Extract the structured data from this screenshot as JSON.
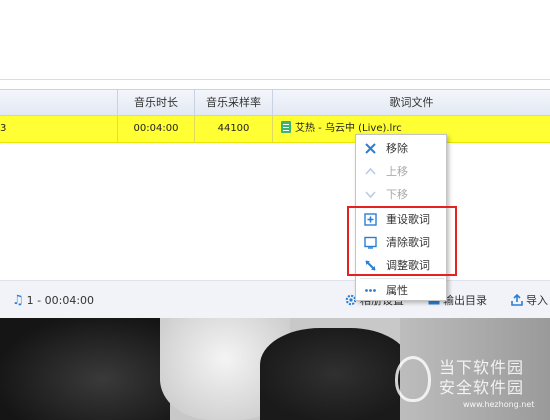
{
  "table": {
    "columns": [
      "音乐时长",
      "音乐采样率",
      "歌词文件"
    ],
    "selected_row": {
      "first_cell_fragment": "3",
      "duration": "00:04:00",
      "sample_rate": "44100",
      "lyric_file": "艾热 - 乌云中 (Live).lrc"
    }
  },
  "context_menu": {
    "items": [
      {
        "label": "移除",
        "icon": "close-icon",
        "enabled": true
      },
      {
        "label": "上移",
        "icon": "chevron-up-icon",
        "enabled": false
      },
      {
        "label": "下移",
        "icon": "chevron-down-icon",
        "enabled": false
      },
      {
        "label": "重设歌词",
        "icon": "reset-lyric-icon",
        "enabled": true
      },
      {
        "label": "清除歌词",
        "icon": "clear-lyric-icon",
        "enabled": true
      },
      {
        "label": "调整歌词",
        "icon": "adjust-lyric-icon",
        "enabled": true
      },
      {
        "label": "属性",
        "icon": "more-icon",
        "enabled": true
      }
    ]
  },
  "status_bar": {
    "count_time": "1 - 00:04:00",
    "settings_label": "相册设置",
    "output_dir_label": "输出目录",
    "import_label": "导入"
  },
  "watermark": {
    "line1": "当下软件园",
    "line2": "安全软件园",
    "url": "www.hezhong.net"
  },
  "colors": {
    "selected_row": "#ffff33",
    "accent_blue": "#2a7fd4",
    "highlight_red": "#e52222"
  }
}
